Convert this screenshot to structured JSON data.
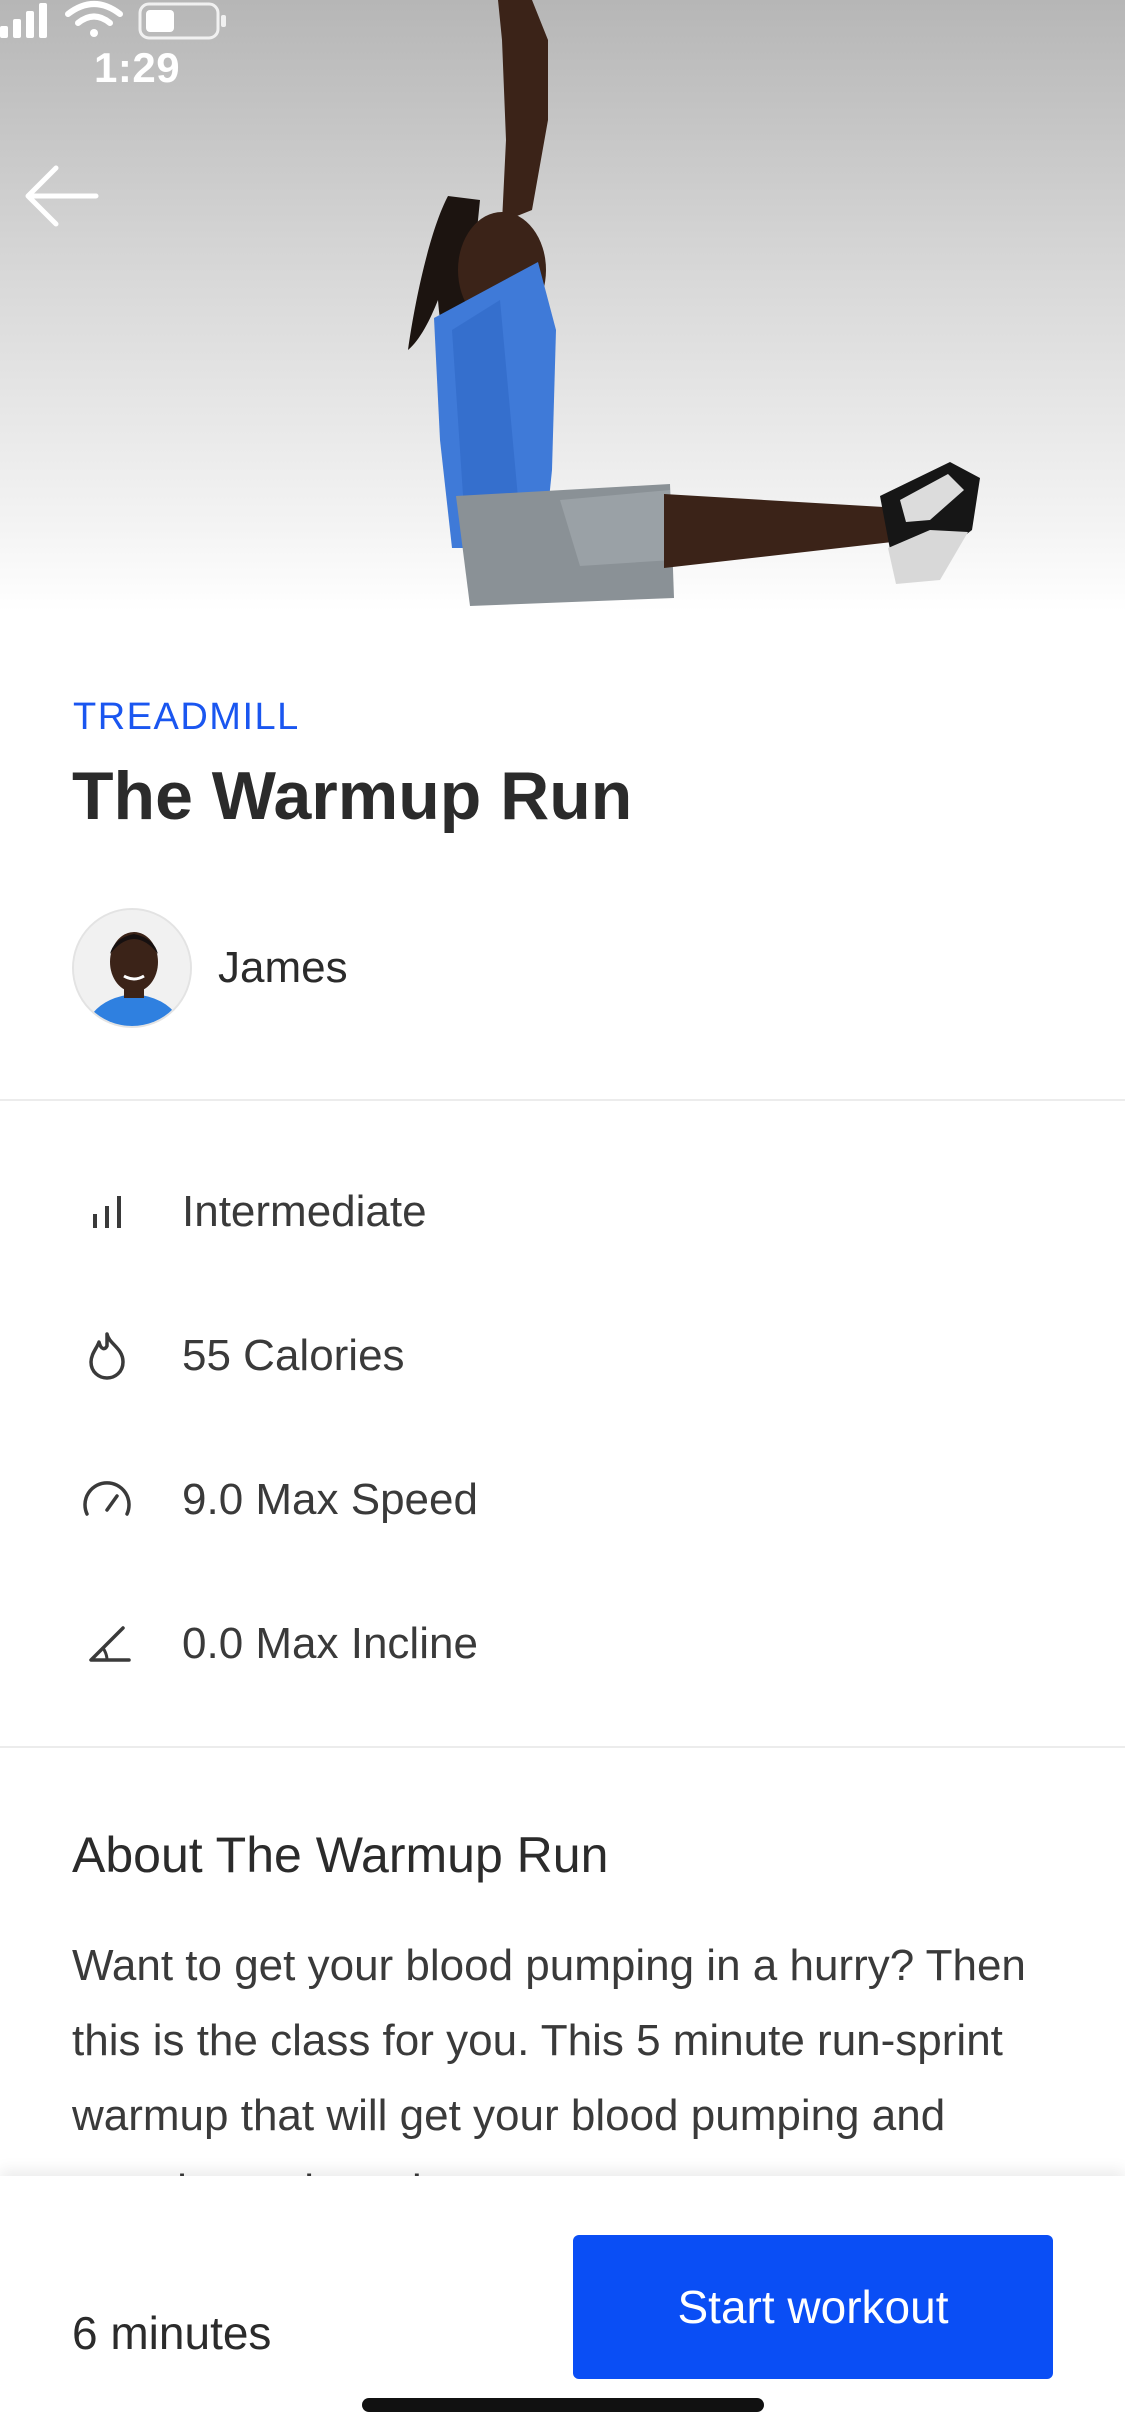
{
  "status_bar": {
    "time": "1:29"
  },
  "workout": {
    "category": "TREADMILL",
    "title": "The Warmup Run",
    "instructor": "James"
  },
  "stats": [
    {
      "icon": "difficulty-bars-icon",
      "label": "Intermediate"
    },
    {
      "icon": "flame-icon",
      "label": "55 Calories"
    },
    {
      "icon": "speedometer-icon",
      "label": "9.0 Max Speed"
    },
    {
      "icon": "incline-angle-icon",
      "label": "0.0 Max Incline"
    }
  ],
  "about": {
    "title": "About The Warmup Run",
    "text": "Want to get your blood pumping in a hurry? Then this is the class for you. This 5 minute run-sprint warmup that will get your blood pumping and muscles activated."
  },
  "footer": {
    "duration": "6 minutes",
    "start_label": "Start workout"
  },
  "colors": {
    "accent": "#1a56f0",
    "button": "#0a4ef5"
  }
}
